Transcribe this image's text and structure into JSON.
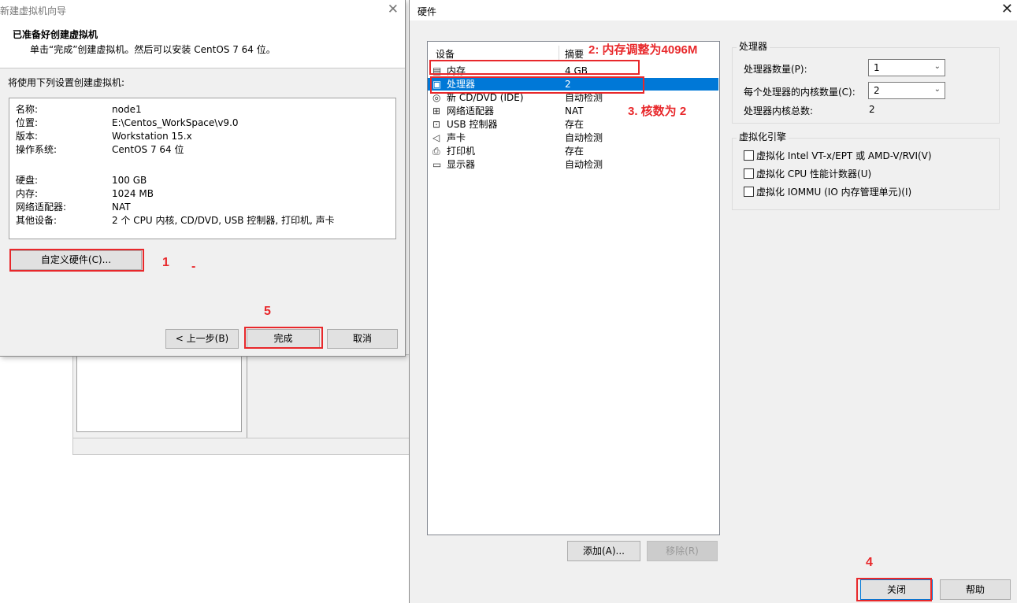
{
  "wizard": {
    "title": "新建虚拟机向导",
    "close_glyph": "✕",
    "heading": "已准备好创建虚拟机",
    "subheading": "单击“完成”创建虚拟机。然后可以安装 CentOS 7 64 位。",
    "section_label": "将使用下列设置创建虚拟机:",
    "summary": [
      {
        "key": "名称:",
        "value": "node1"
      },
      {
        "key": "位置:",
        "value": "E:\\Centos_WorkSpace\\v9.0"
      },
      {
        "key": "版本:",
        "value": "Workstation 15.x"
      },
      {
        "key": "操作系统:",
        "value": "CentOS 7 64 位"
      },
      {
        "key": "硬盘:",
        "value": "100 GB"
      },
      {
        "key": "内存:",
        "value": "1024 MB"
      },
      {
        "key": "网络适配器:",
        "value": "NAT"
      },
      {
        "key": "其他设备:",
        "value": "2 个 CPU 内核, CD/DVD, USB 控制器, 打印机, 声卡"
      }
    ],
    "customize_button": "自定义硬件(C)...",
    "prev_button": "< 上一步(B)",
    "finish_button": "完成",
    "cancel_button": "取消"
  },
  "hardware": {
    "title": "硬件",
    "close_glyph": "✕",
    "columns": {
      "device": "设备",
      "summary": "摘要"
    },
    "devices": [
      {
        "icon": "memory-icon",
        "glyph": "▤",
        "name": "内存",
        "summary": "4 GB",
        "selected": false
      },
      {
        "icon": "processor-icon",
        "glyph": "▣",
        "name": "处理器",
        "summary": "2",
        "selected": true
      },
      {
        "icon": "cd-dvd-icon",
        "glyph": "◎",
        "name": "新 CD/DVD (IDE)",
        "summary": "自动检测",
        "selected": false
      },
      {
        "icon": "network-adapter-icon",
        "glyph": "⊞",
        "name": "网络适配器",
        "summary": "NAT",
        "selected": false
      },
      {
        "icon": "usb-controller-icon",
        "glyph": "⊡",
        "name": "USB 控制器",
        "summary": "存在",
        "selected": false
      },
      {
        "icon": "sound-card-icon",
        "glyph": "◁",
        "name": "声卡",
        "summary": "自动检测",
        "selected": false
      },
      {
        "icon": "printer-icon",
        "glyph": "⎙",
        "name": "打印机",
        "summary": "存在",
        "selected": false
      },
      {
        "icon": "display-icon",
        "glyph": "▭",
        "name": "显示器",
        "summary": "自动检测",
        "selected": false
      }
    ],
    "add_button": "添加(A)...",
    "remove_button": "移除(R)",
    "close_button": "关闭",
    "help_button": "帮助",
    "processor_group": {
      "label": "处理器",
      "count_label": "处理器数量(P):",
      "count_value": "1",
      "cores_label": "每个处理器的内核数量(C):",
      "cores_value": "2",
      "total_label": "处理器内核总数:",
      "total_value": "2"
    },
    "virtualization_group": {
      "label": "虚拟化引擎",
      "options": [
        {
          "label": "虚拟化 Intel VT-x/EPT 或 AMD-V/RVI(V)",
          "checked": false
        },
        {
          "label": "虚拟化 CPU 性能计数器(U)",
          "checked": false
        },
        {
          "label": "虚拟化 IOMMU (IO 内存管理单元)(I)",
          "checked": false
        }
      ]
    }
  },
  "annotations": {
    "step1": "1",
    "step1_dash": "-",
    "step2": "2: 内存调整为4096M",
    "step3": "3. 核数为 2",
    "step4": "4",
    "step5": "5",
    "color": "#e8282b"
  },
  "colors": {
    "selection": "#0078d7",
    "dialog_bg": "#f0f0f0"
  }
}
